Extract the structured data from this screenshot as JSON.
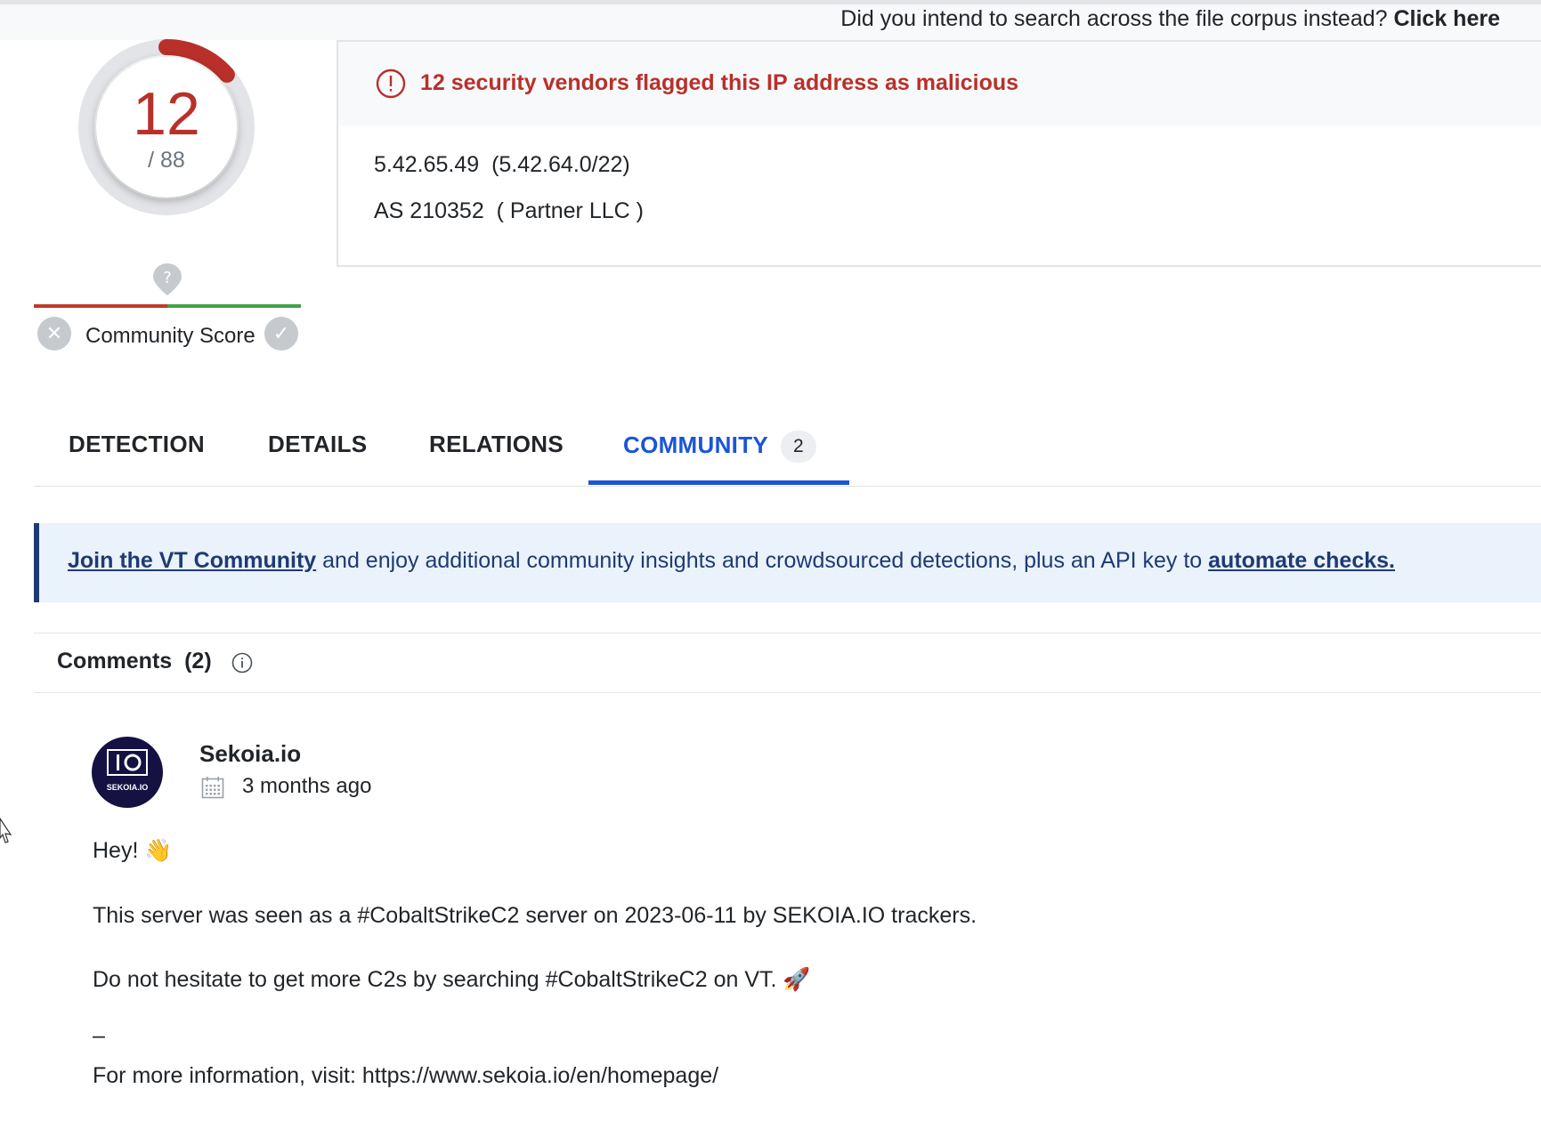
{
  "topbar": {
    "prompt": "Did you intend to search across the file corpus instead?",
    "link": "Click here"
  },
  "score": {
    "detections": "12",
    "total": "/ 88",
    "fraction": 0.136,
    "color": "#b9302a"
  },
  "community": {
    "label": "Community Score",
    "icons": [
      "question-mark-pin-icon",
      "close-icon",
      "check-icon"
    ]
  },
  "summary": {
    "alert": "12 security vendors flagged this IP address as malicious",
    "ip": "5.42.65.49",
    "network": "(5.42.64.0/22)",
    "asn": "AS 210352",
    "as_owner": "( Partner LLC )"
  },
  "tabs": [
    {
      "label": "DETECTION"
    },
    {
      "label": "DETAILS"
    },
    {
      "label": "RELATIONS"
    },
    {
      "label": "COMMUNITY",
      "badge": "2",
      "active": true
    }
  ],
  "banner": {
    "link1": "Join the VT Community",
    "middle": " and enjoy additional community insights and crowdsourced detections, plus an API key to ",
    "link2": "automate checks."
  },
  "comments": {
    "title": "Comments",
    "count": "(2)",
    "items": [
      {
        "avatar_text": "SEKOIA.IO",
        "author": "Sekoia.io",
        "time": "3 months ago",
        "lines": [
          "Hey! 👋",
          "This server was seen as a #CobaltStrikeC2 server on 2023-06-11 by SEKOIA.IO trackers.",
          "Do not hesitate to get more C2s by searching #CobaltStrikeC2 on VT. 🚀",
          "–",
          "For more information, visit: https://www.sekoia.io/en/homepage/"
        ]
      }
    ]
  },
  "colors": {
    "malicious": "#b9302a",
    "accent": "#1a55d6",
    "banner_bg": "#eaf2fb",
    "banner_text": "#1f3a73"
  }
}
